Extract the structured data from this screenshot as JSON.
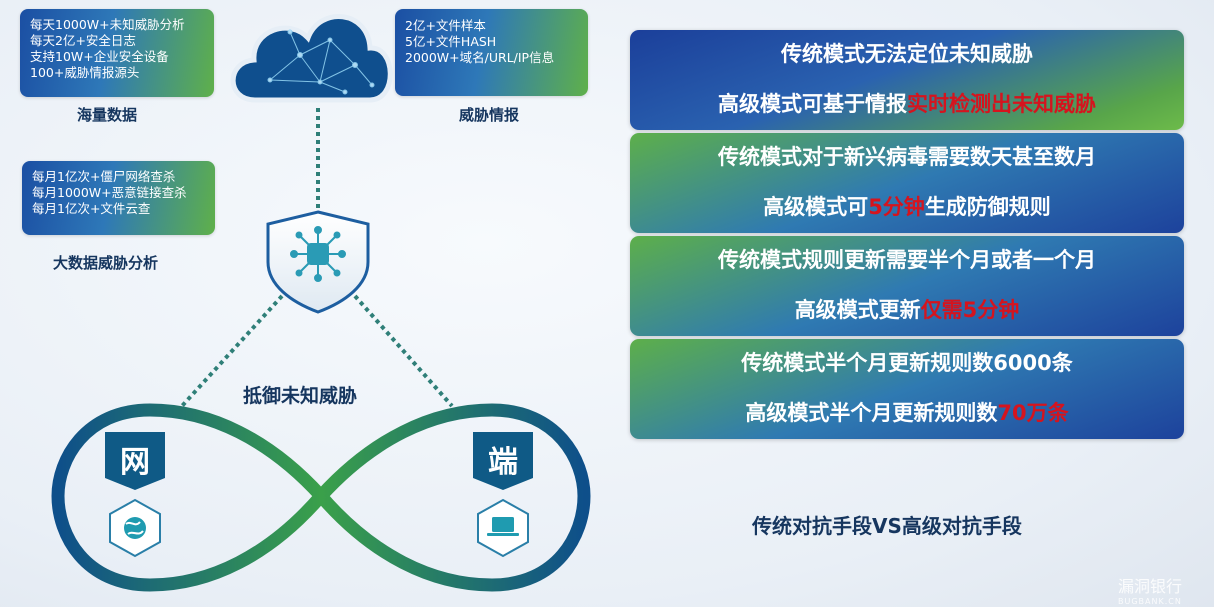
{
  "left": {
    "box1": {
      "lines": [
        "每天1000W+未知威胁分析",
        "每天2亿+安全日志",
        "支持10W+企业安全设备",
        "100+威胁情报源头"
      ],
      "caption": "海量数据"
    },
    "box2": {
      "lines": [
        "2亿+文件样本",
        "5亿+文件HASH",
        "2000W+域名/URL/IP信息"
      ],
      "caption": "威胁情报"
    },
    "box3": {
      "lines": [
        "每月1亿次+僵尸网络查杀",
        "每月1000W+恶意链接查杀",
        "每月1亿次+文件云查"
      ],
      "caption": "大数据威胁分析"
    },
    "center_caption": "抵御未知威胁",
    "net_label": "网",
    "end_label": "端"
  },
  "comparisons": [
    {
      "line1": "传统模式无法定位未知威胁",
      "line2_plain": "高级模式可基于情报",
      "line2_red": "实时检测出未知威胁",
      "line2_after": ""
    },
    {
      "line1": "传统模式对于新兴病毒需要数天甚至数月",
      "line2_plain": "高级模式可",
      "line2_red": "5分钟",
      "line2_after": "生成防御规则"
    },
    {
      "line1": "传统模式规则更新需要半个月或者一个月",
      "line2_plain": "高级模式更新",
      "line2_red": "仅需5分钟",
      "line2_after": ""
    },
    {
      "line1": "传统模式半个月更新规则数6000条",
      "line2_plain": "高级模式半个月更新规则数",
      "line2_red": "70万条",
      "line2_after": ""
    }
  ],
  "right_title": "传统对抗手段VS高级对抗手段",
  "watermark": {
    "main": "漏洞银行",
    "sub": "BUGBANK.CN"
  },
  "colors": {
    "navy": "#16365f",
    "accent_red": "#d5141e",
    "teal": "#1f9bb0",
    "green": "#4fa845"
  }
}
